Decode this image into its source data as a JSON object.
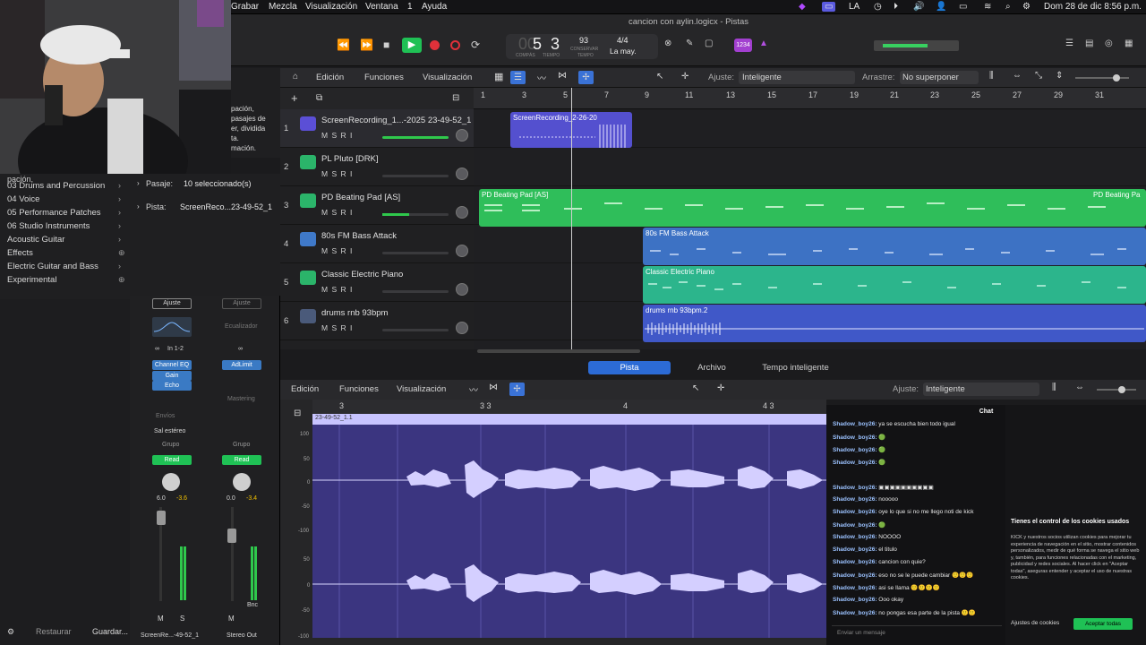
{
  "menubar": {
    "items": [
      "Grabar",
      "Mezcla",
      "Visualización",
      "Ventana",
      "1",
      "Ayuda"
    ],
    "input_source": "LA",
    "datetime": "Dom 28 de dic  8:56 p.m."
  },
  "transport": {
    "window_title": "cancion con aylin.logicx - Pistas",
    "position_bars": "5",
    "position_beats": "3",
    "position_bars_label": "COMPÁS",
    "position_beats_label": "TIEMPO",
    "tempo": "93",
    "tempo_label": "CONSERVAR",
    "tempo_sub": "TEMPO",
    "time_signature": "4/4",
    "key": "La may.",
    "count_in": "1234"
  },
  "library": {
    "items": [
      "03 Drums and Percussion",
      "04 Voice",
      "05 Performance Patches",
      "06 Studio Instruments",
      "Acoustic Guitar",
      "Effects",
      "Electric Guitar and Bass",
      "Experimental"
    ],
    "partial_text": [
      "pación,",
      "pasajes de",
      "er, dividida",
      "ta.",
      "mación."
    ],
    "restore_label": "Restaurar",
    "save_label": "Guardar..."
  },
  "inspector": {
    "region_label": "Pasaje:",
    "region_value": "10 seleccionado(s)",
    "track_label": "Pista:",
    "track_value": "ScreenReco...23-49-52_1"
  },
  "channel_strips": [
    {
      "setting": "Ajuste",
      "eq": "",
      "input": "In 1-2",
      "plugins": [
        "Channel EQ",
        "Gain",
        "Echo"
      ],
      "sends": "Envíos",
      "output": "Sal estéreo",
      "group": "Grupo",
      "automation": "Read",
      "volume": "6.0",
      "peak": "-3.6",
      "name": "ScreenRe...-49-52_1",
      "buttons": [
        "M",
        "S"
      ]
    },
    {
      "setting": "Ajuste",
      "eq": "Ecualizador",
      "input": "",
      "plugins": [
        "AdLimit"
      ],
      "sends": "Mastering",
      "output": "",
      "group": "Grupo",
      "automation": "Read",
      "volume": "0.0",
      "peak": "-3.4",
      "name": "Stereo Out",
      "buttons": [
        "M"
      ],
      "extra": "Bnc"
    }
  ],
  "tracks_toolbar": {
    "edit": "Edición",
    "functions": "Funciones",
    "view": "Visualización",
    "snap_label": "Ajuste:",
    "snap_value": "Inteligente",
    "drag_label": "Arrastre:",
    "drag_value": "No superponer"
  },
  "ruler": {
    "bars": [
      "1",
      "3",
      "5",
      "7",
      "9",
      "11",
      "13",
      "15",
      "17",
      "19",
      "21",
      "23",
      "25",
      "27",
      "29",
      "31"
    ]
  },
  "tracks": [
    {
      "num": "1",
      "name": "ScreenRecording_1...-2025 23-49-52_1",
      "color": "#5b4fd6",
      "btns": "M S R I"
    },
    {
      "num": "2",
      "name": "PL Pluto [DRK]",
      "color": "#2bb46a",
      "btns": "M S R I"
    },
    {
      "num": "3",
      "name": "PD Beating Pad [AS]",
      "color": "#2bb46a",
      "btns": "M S R I"
    },
    {
      "num": "4",
      "name": "80s FM Bass Attack",
      "color": "#3f79c9",
      "btns": "M S R I"
    },
    {
      "num": "5",
      "name": "Classic Electric Piano",
      "color": "#2bb46a",
      "btns": "M S R I"
    },
    {
      "num": "6",
      "name": "drums rnb 93bpm",
      "color": "#4a5a7a",
      "btns": "M S R I"
    }
  ],
  "regions": {
    "r1": "ScreenRecording_2-26-20",
    "r3a": "PD Beating Pad [AS]",
    "r3b": "PD Beating Pa",
    "r4": "80s FM Bass Attack",
    "r5": "Classic Electric Piano",
    "r6": "drums rnb 93bpm.2"
  },
  "editor": {
    "tabs": [
      "Pista",
      "Archivo",
      "Tempo inteligente"
    ],
    "edit": "Edición",
    "functions": "Funciones",
    "view": "Visualización",
    "snap_label": "Ajuste:",
    "snap_value": "Inteligente",
    "ruler": [
      "3",
      "3 3",
      "4",
      "4 3"
    ],
    "region_name": "23-49-52_1.1",
    "scale": [
      "100",
      "50",
      "0",
      "-50",
      "-100",
      "50",
      "0",
      "-50",
      "-100"
    ]
  },
  "chat": {
    "title": "Chat",
    "messages": [
      {
        "user": "Shadow_boy26:",
        "text": "ya se escucha bien todo igual"
      },
      {
        "user": "Shadow_boy26:",
        "text": "🟢"
      },
      {
        "user": "Shadow_boy26:",
        "text": "🟢"
      },
      {
        "user": "Shadow_boy26:",
        "text": "🟢"
      },
      {
        "user": "Shadow_boy26:",
        "text": "▣▣▣▣▣▣▣▣▣▣"
      },
      {
        "user": "Shadow_boy26:",
        "text": "nooooo"
      },
      {
        "user": "Shadow_boy26:",
        "text": "oye lo que si no me llego noti de kick"
      },
      {
        "user": "Shadow_boy26:",
        "text": "🟢"
      },
      {
        "user": "Shadow_boy26:",
        "text": "NOOOO"
      },
      {
        "user": "Shadow_boy26:",
        "text": "el titulo"
      },
      {
        "user": "Shadow_boy26:",
        "text": "cancion con quie?"
      },
      {
        "user": "Shadow_boy26:",
        "text": "eso no se le puede cambiar 🙂🙂🙂"
      },
      {
        "user": "Shadow_boy26:",
        "text": "asi se llama 🙂🙂🙂🙂"
      },
      {
        "user": "Shadow_boy26:",
        "text": "Ooo okay"
      },
      {
        "user": "Shadow_boy26:",
        "text": "no pongas esa parte de la pista 🙂🙂"
      }
    ],
    "placeholder": "Enviar un mensaje"
  },
  "cookie": {
    "title": "Tienes el control de los cookies usados",
    "body": "KICK y nuestros socios utilizan cookies para mejorar tu experiencia de navegación en el sitio, mostrar contenidos personalizados, medir de qué forma se navega el sitio web y, también, para funciones relacionadas con el marketing, publicidad y redes sociales. Al hacer click en \"Aceptar todas\", aseguras entender y aceptar el uso de nuestras cookies.",
    "settings": "Ajustes de cookies",
    "accept": "Aceptar todas"
  }
}
